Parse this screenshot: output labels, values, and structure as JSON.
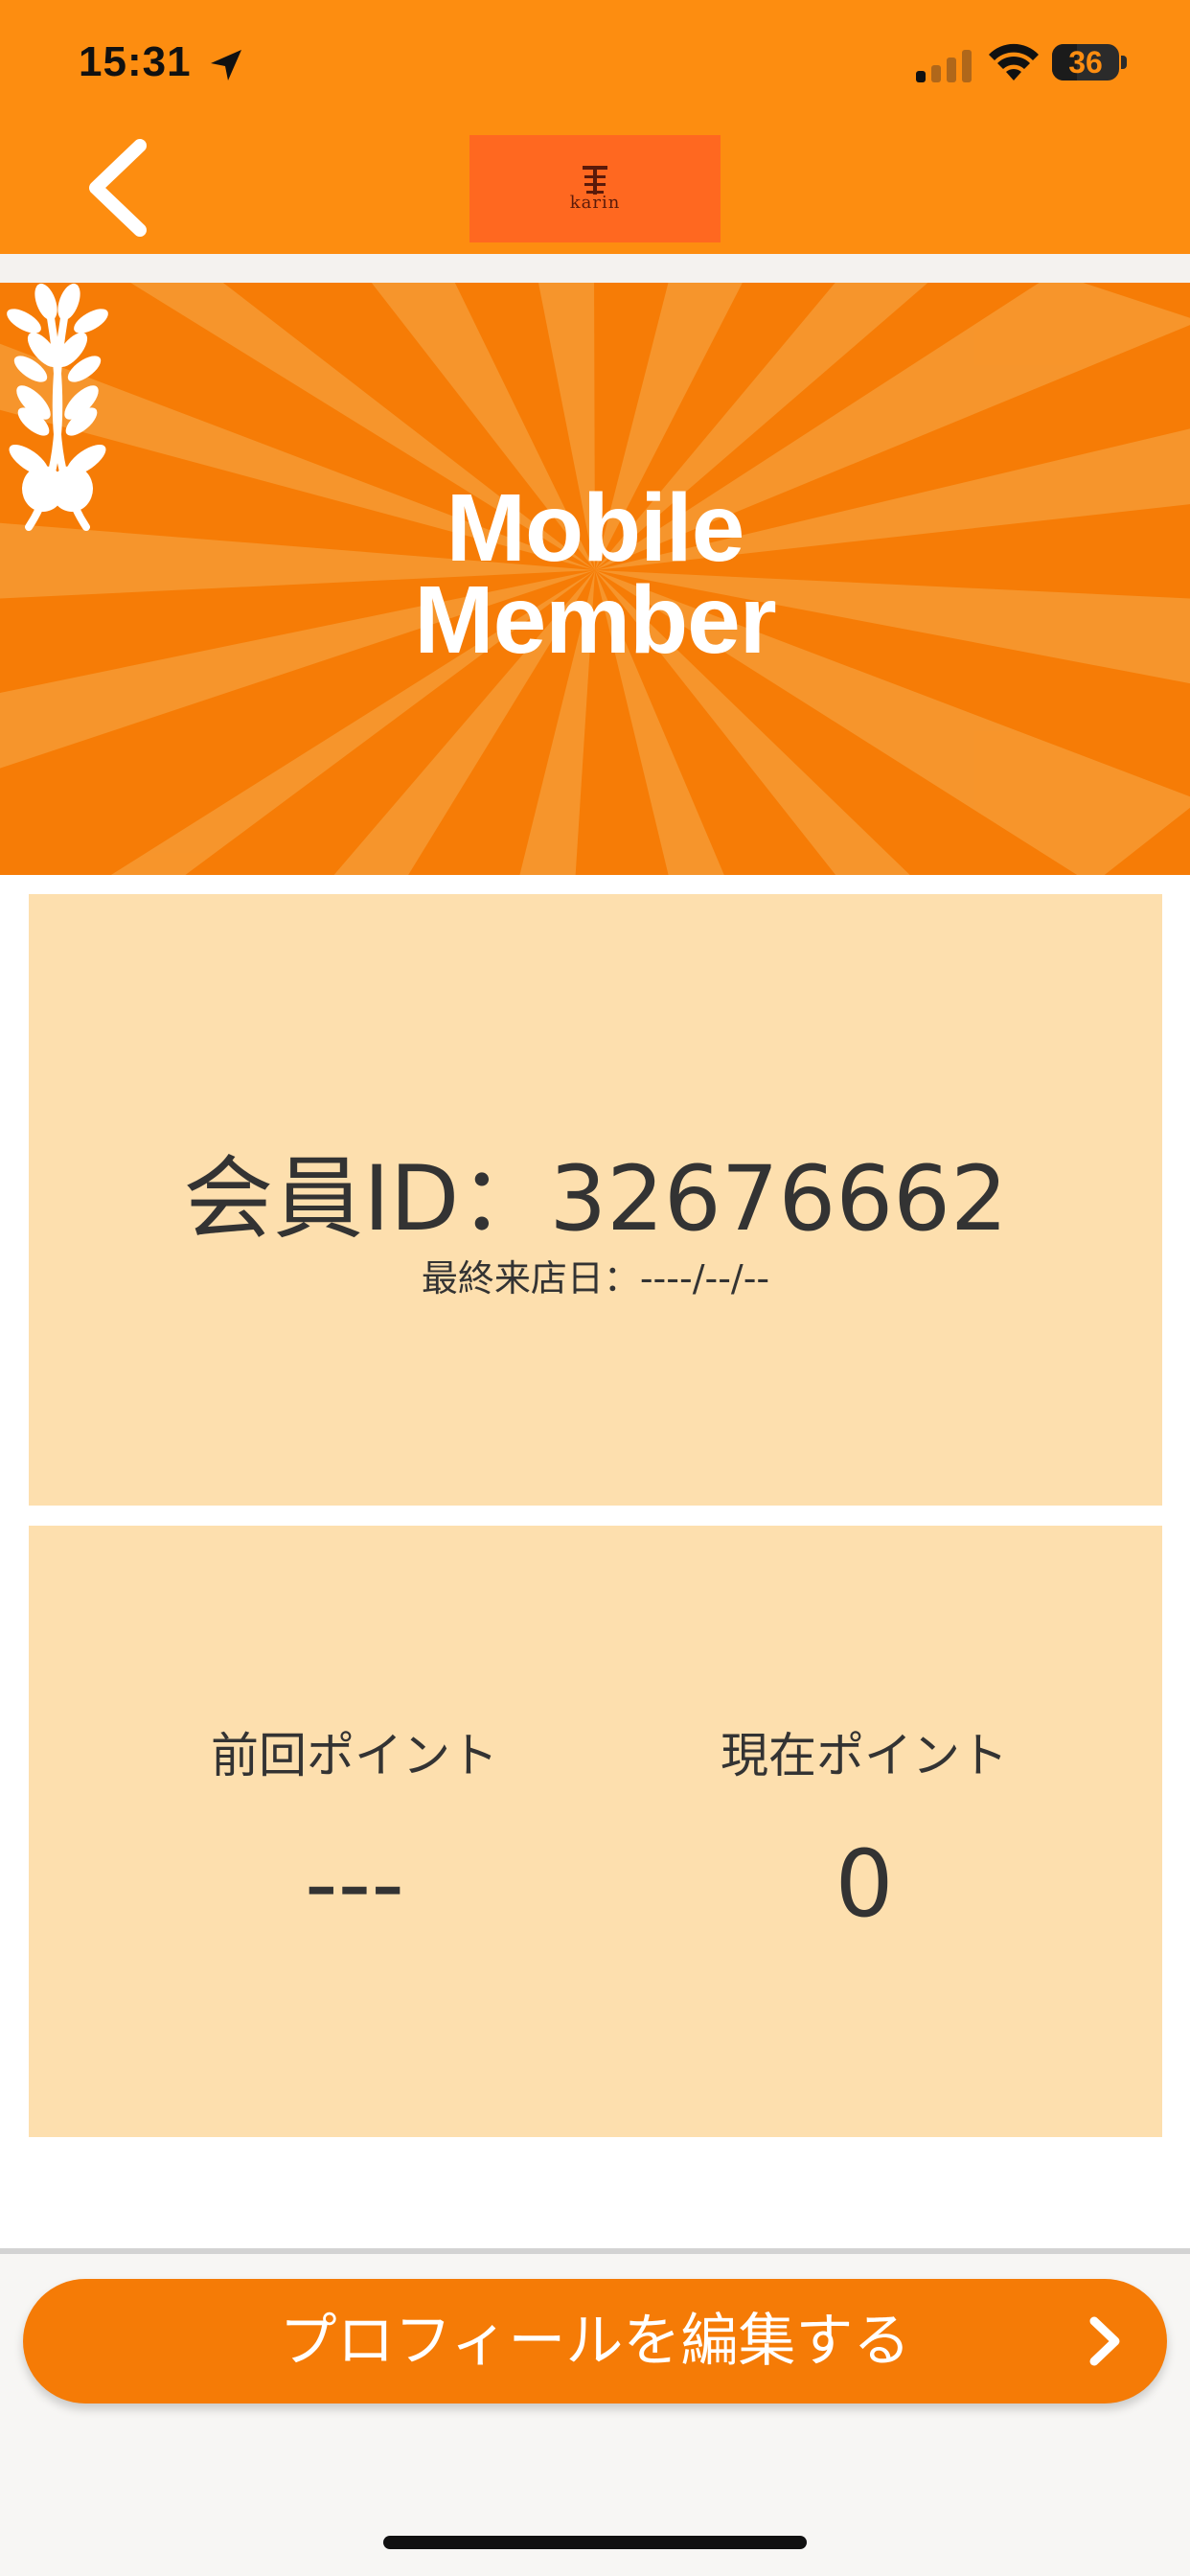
{
  "status_bar": {
    "time": "15:31",
    "battery": "36"
  },
  "header": {
    "logo_text": "karin",
    "colors": {
      "background": "#fd8d10",
      "logo_bg": "#ff6820"
    }
  },
  "banner": {
    "title_line1": "Mobile",
    "title_line2": "Member",
    "colors": {
      "background": "#f67c06",
      "rays": "#f79a33"
    }
  },
  "member": {
    "id_line": "会員ID：32676662",
    "last_visit": "最終来店日：----/--/--"
  },
  "points": {
    "previous_label": "前回ポイント",
    "previous_value": "---",
    "current_label": "現在ポイント",
    "current_value": "0"
  },
  "actions": {
    "edit_profile": "プロフィールを編集する"
  },
  "icons": [
    "location-arrow-icon",
    "signal-icon",
    "wifi-icon",
    "battery-icon",
    "back-chevron-icon",
    "laurel-left-icon",
    "laurel-right-icon",
    "chevron-right-icon"
  ]
}
